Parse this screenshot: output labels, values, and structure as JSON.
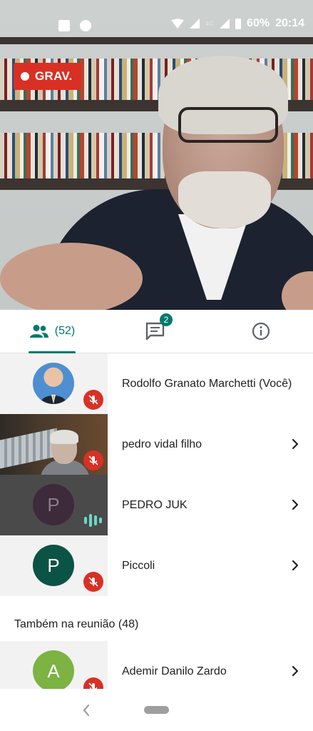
{
  "status_bar": {
    "battery": "60%",
    "time": "20:14",
    "network": "4G",
    "icons": [
      "image-icon",
      "chat-bubble-icon",
      "wifi-icon",
      "signal-icon",
      "battery-icon"
    ]
  },
  "video": {
    "recording_label": "GRAV."
  },
  "tabs": {
    "people_count": "(52)",
    "chat_badge": "2",
    "icons": [
      "people-icon",
      "chat-icon",
      "info-icon"
    ]
  },
  "participants": [
    {
      "name": "Rodolfo Granato Marchetti (Você)",
      "avatar_type": "photo",
      "mic": "muted",
      "has_chevron": false
    },
    {
      "name": "pedro vidal filho",
      "avatar_type": "video",
      "mic": "muted",
      "has_chevron": true
    },
    {
      "name": "PEDRO JUK",
      "avatar_letter": "P",
      "avatar_color": "#3d2a3a",
      "mic": "speaking",
      "has_chevron": true
    },
    {
      "name": "Piccoli",
      "avatar_letter": "P",
      "avatar_color": "#0b5345",
      "mic": "muted",
      "has_chevron": true
    }
  ],
  "also_in_meeting": {
    "label": "Também na reunião (48)",
    "participants": [
      {
        "name": "Ademir Danilo Zardo",
        "avatar_letter": "A",
        "avatar_color": "#7cb342",
        "mic": "muted",
        "has_chevron": true
      }
    ]
  },
  "colors": {
    "accent": "#00796b",
    "recording": "#d93025",
    "mic_off": "#d93025",
    "speaking": "#6ed6c9"
  }
}
